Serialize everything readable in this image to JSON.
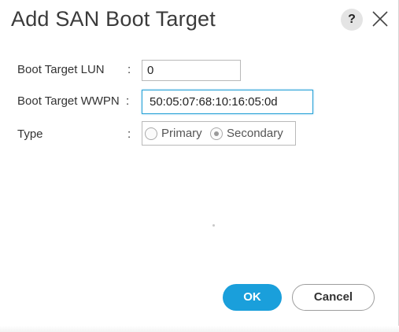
{
  "dialog": {
    "title": "Add SAN Boot Target",
    "help_label": "?",
    "help_icon": "question-icon",
    "close_icon": "close-icon"
  },
  "form": {
    "lun": {
      "label": "Boot Target LUN",
      "separator": ":",
      "value": "0"
    },
    "wwpn": {
      "label": "Boot Target WWPN",
      "separator": ":",
      "value": "50:05:07:68:10:16:05:0d"
    },
    "type": {
      "label": "Type",
      "separator": ":",
      "options": [
        {
          "label": "Primary",
          "selected": false
        },
        {
          "label": "Secondary",
          "selected": true
        }
      ]
    }
  },
  "buttons": {
    "ok_label": "OK",
    "cancel_label": "Cancel"
  },
  "colors": {
    "accent": "#1a9fdb",
    "focus_border": "#2aa3d8"
  }
}
